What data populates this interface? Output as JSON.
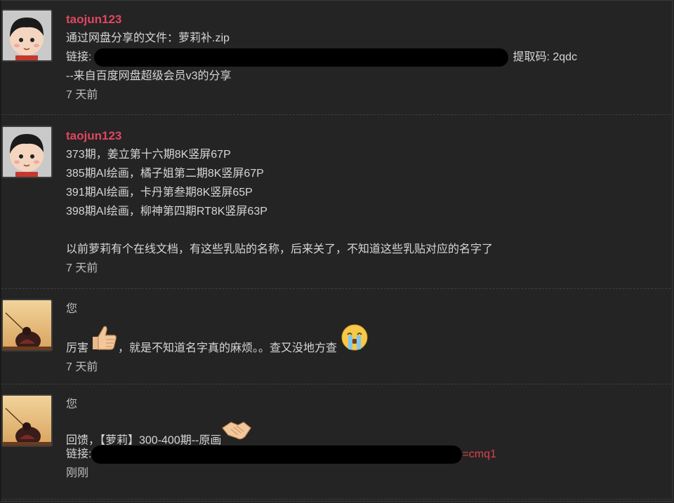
{
  "messages": [
    {
      "author": "taojun123",
      "lines": [
        "通过网盘分享的文件：萝莉补.zip",
        "链接:",
        "提取码: 2qdc",
        "--来自百度网盘超级会员v3的分享"
      ],
      "time": "7 天前"
    },
    {
      "author": "taojun123",
      "lines": [
        "373期，姜立第十六期8K竖屏67P",
        "385期AI绘画，橘子姐第二期8K竖屏67P",
        "391期AI绘画，卡丹第叁期8K竖屏65P",
        "398期AI绘画，柳神第四期RT8K竖屏63P",
        "",
        "以前萝莉有个在线文档，有这些乳贴的名称，后来关了，不知道这些乳贴对应的名字了"
      ],
      "time": "7 天前"
    },
    {
      "author": "您",
      "text_before": "厉害",
      "emoji1": "thumbs-up-icon",
      "text_after": "，就是不知道名字真的麻烦。。查又没地方查",
      "emoji2": "crying-face-icon",
      "time": "7 天前"
    },
    {
      "author": "您",
      "reply": "回馈，【萝莉】300-400期--原画",
      "emoji": "handshake-icon",
      "link_label": "链接:",
      "link_tail": "=cmq1",
      "time": "刚刚"
    }
  ],
  "colors": {
    "background": "#242424",
    "username": "#e0475e",
    "text": "#d6d6d6",
    "link_red": "#d9414c"
  }
}
